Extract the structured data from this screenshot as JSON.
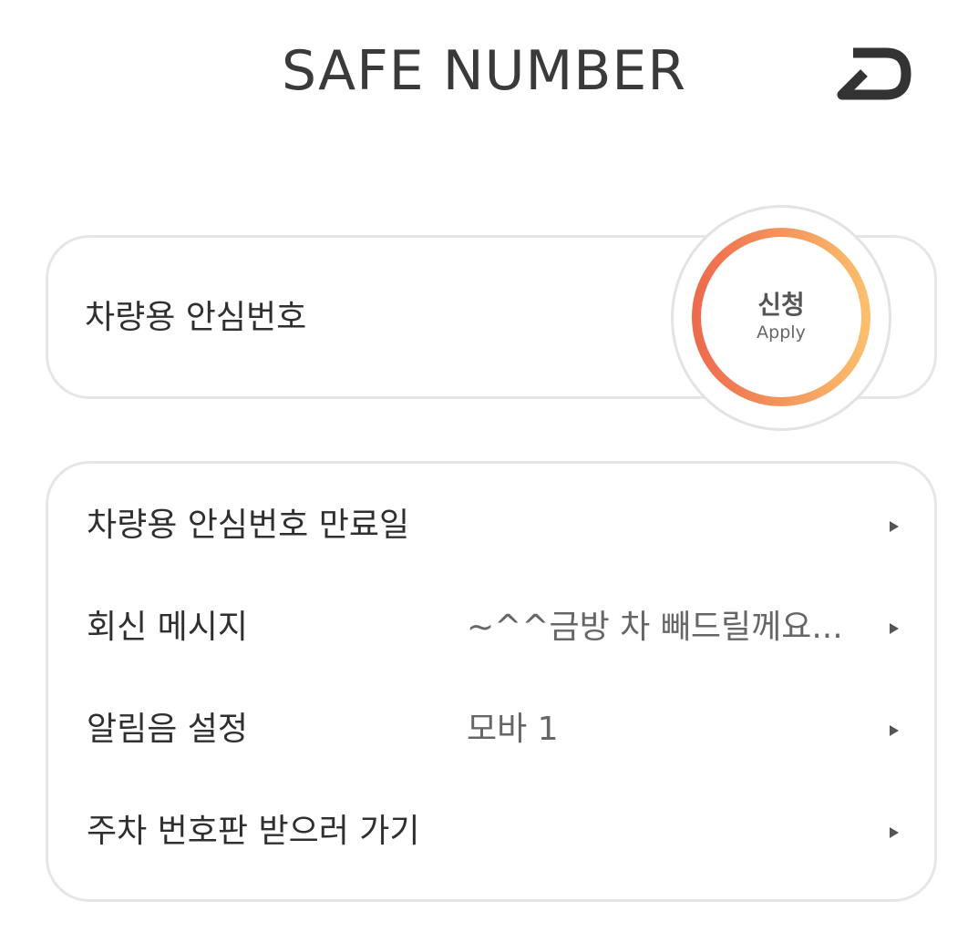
{
  "header": {
    "title": "SAFE NUMBER",
    "back_icon": "back-arrow-icon"
  },
  "apply_card": {
    "title": "차량용 안심번호",
    "button_label_ko": "신청",
    "button_label_en": "Apply",
    "ring_gradient": [
      "#ee6a4d",
      "#fbbf6c"
    ]
  },
  "menu": {
    "items": [
      {
        "label": "차량용 안심번호 만료일",
        "value": ""
      },
      {
        "label": "회신 메시지",
        "value": "~^^금방 차 빼드릴께요..."
      },
      {
        "label": "알림음 설정",
        "value": "모바 1"
      },
      {
        "label": "주차 번호판 받으러 가기",
        "value": ""
      }
    ],
    "arrow_icon": "chevron-right-icon"
  }
}
